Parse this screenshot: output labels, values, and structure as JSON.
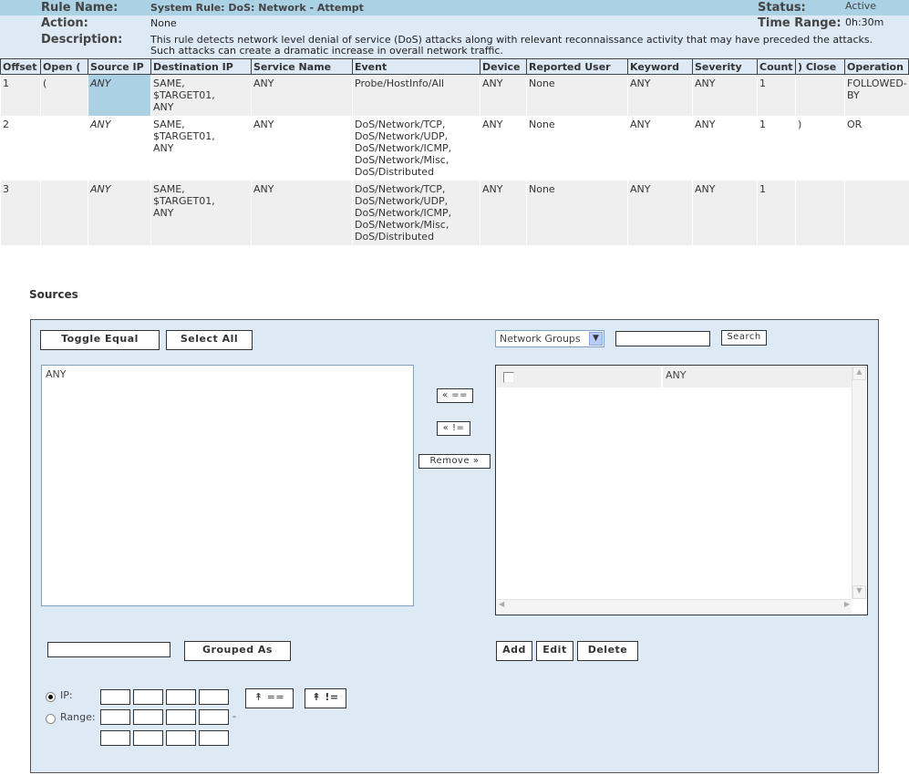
{
  "header": {
    "rule_name_label": "Rule Name:",
    "rule_name": "System Rule: DoS: Network - Attempt",
    "status_label": "Status:",
    "status": "Active",
    "action_label": "Action:",
    "action": "None",
    "time_range_label": "Time Range:",
    "time_range": "0h:30m",
    "description_label": "Description:",
    "description_1": "This rule detects network level denial of service (DoS) attacks along with relevant reconnaissance activity that may have preceded the attacks.",
    "description_2": "Such attacks can create a dramatic increase in overall network traffic."
  },
  "table": {
    "columns": [
      "Offset",
      "Open (",
      "Source IP",
      "Destination IP",
      "Service Name",
      "Event",
      "Device",
      "Reported User",
      "Keyword",
      "Severity",
      "Count",
      ") Close",
      "Operation"
    ],
    "rows": [
      {
        "offset": "1",
        "open": "(",
        "source": "ANY",
        "dest": [
          "SAME,",
          "$TARGET01,",
          "ANY"
        ],
        "service": "ANY",
        "event": [
          "Probe/HostInfo/All"
        ],
        "device": "ANY",
        "user": "None",
        "keyword": "ANY",
        "severity": "ANY",
        "count": "1",
        "close": "",
        "operation": "FOLLOWED-BY"
      },
      {
        "offset": "2",
        "open": "",
        "source": "ANY",
        "dest": [
          "SAME,",
          "$TARGET01,",
          "ANY"
        ],
        "service": "ANY",
        "event": [
          "DoS/Network/TCP,",
          "DoS/Network/UDP,",
          "DoS/Network/ICMP,",
          "DoS/Network/Misc,",
          "DoS/Distributed"
        ],
        "device": "ANY",
        "user": "None",
        "keyword": "ANY",
        "severity": "ANY",
        "count": "1",
        "close": ")",
        "operation": "OR"
      },
      {
        "offset": "3",
        "open": "",
        "source": "ANY",
        "dest": [
          "SAME,",
          "$TARGET01,",
          "ANY"
        ],
        "service": "ANY",
        "event": [
          "DoS/Network/TCP,",
          "DoS/Network/UDP,",
          "DoS/Network/ICMP,",
          "DoS/Network/Misc,",
          "DoS/Distributed"
        ],
        "device": "ANY",
        "user": "None",
        "keyword": "ANY",
        "severity": "ANY",
        "count": "1",
        "close": "",
        "operation": ""
      }
    ]
  },
  "sources": {
    "title": "Sources",
    "toggle_equal": "Toggle Equal",
    "select_all": "Select All",
    "group_select": "Network Groups",
    "search_value": "",
    "search_button": "Search",
    "selected_items": [
      "ANY"
    ],
    "add_eq": "==",
    "add_neq": "!=",
    "remove": "Remove",
    "group_list": [
      {
        "checked": false,
        "name": "ANY"
      }
    ],
    "grouped_as_value": "",
    "grouped_as": "Grouped As",
    "add": "Add",
    "edit": "Edit",
    "delete": "Delete",
    "ip_label": "IP:",
    "range_label": "Range:",
    "ip_mode": "IP",
    "range_dash": "-",
    "up_eq": "==",
    "up_neq": "!="
  },
  "colors": {
    "header_dark": "#abd1e5",
    "header_light": "#dde9f5",
    "row_gray": "#efefef"
  }
}
